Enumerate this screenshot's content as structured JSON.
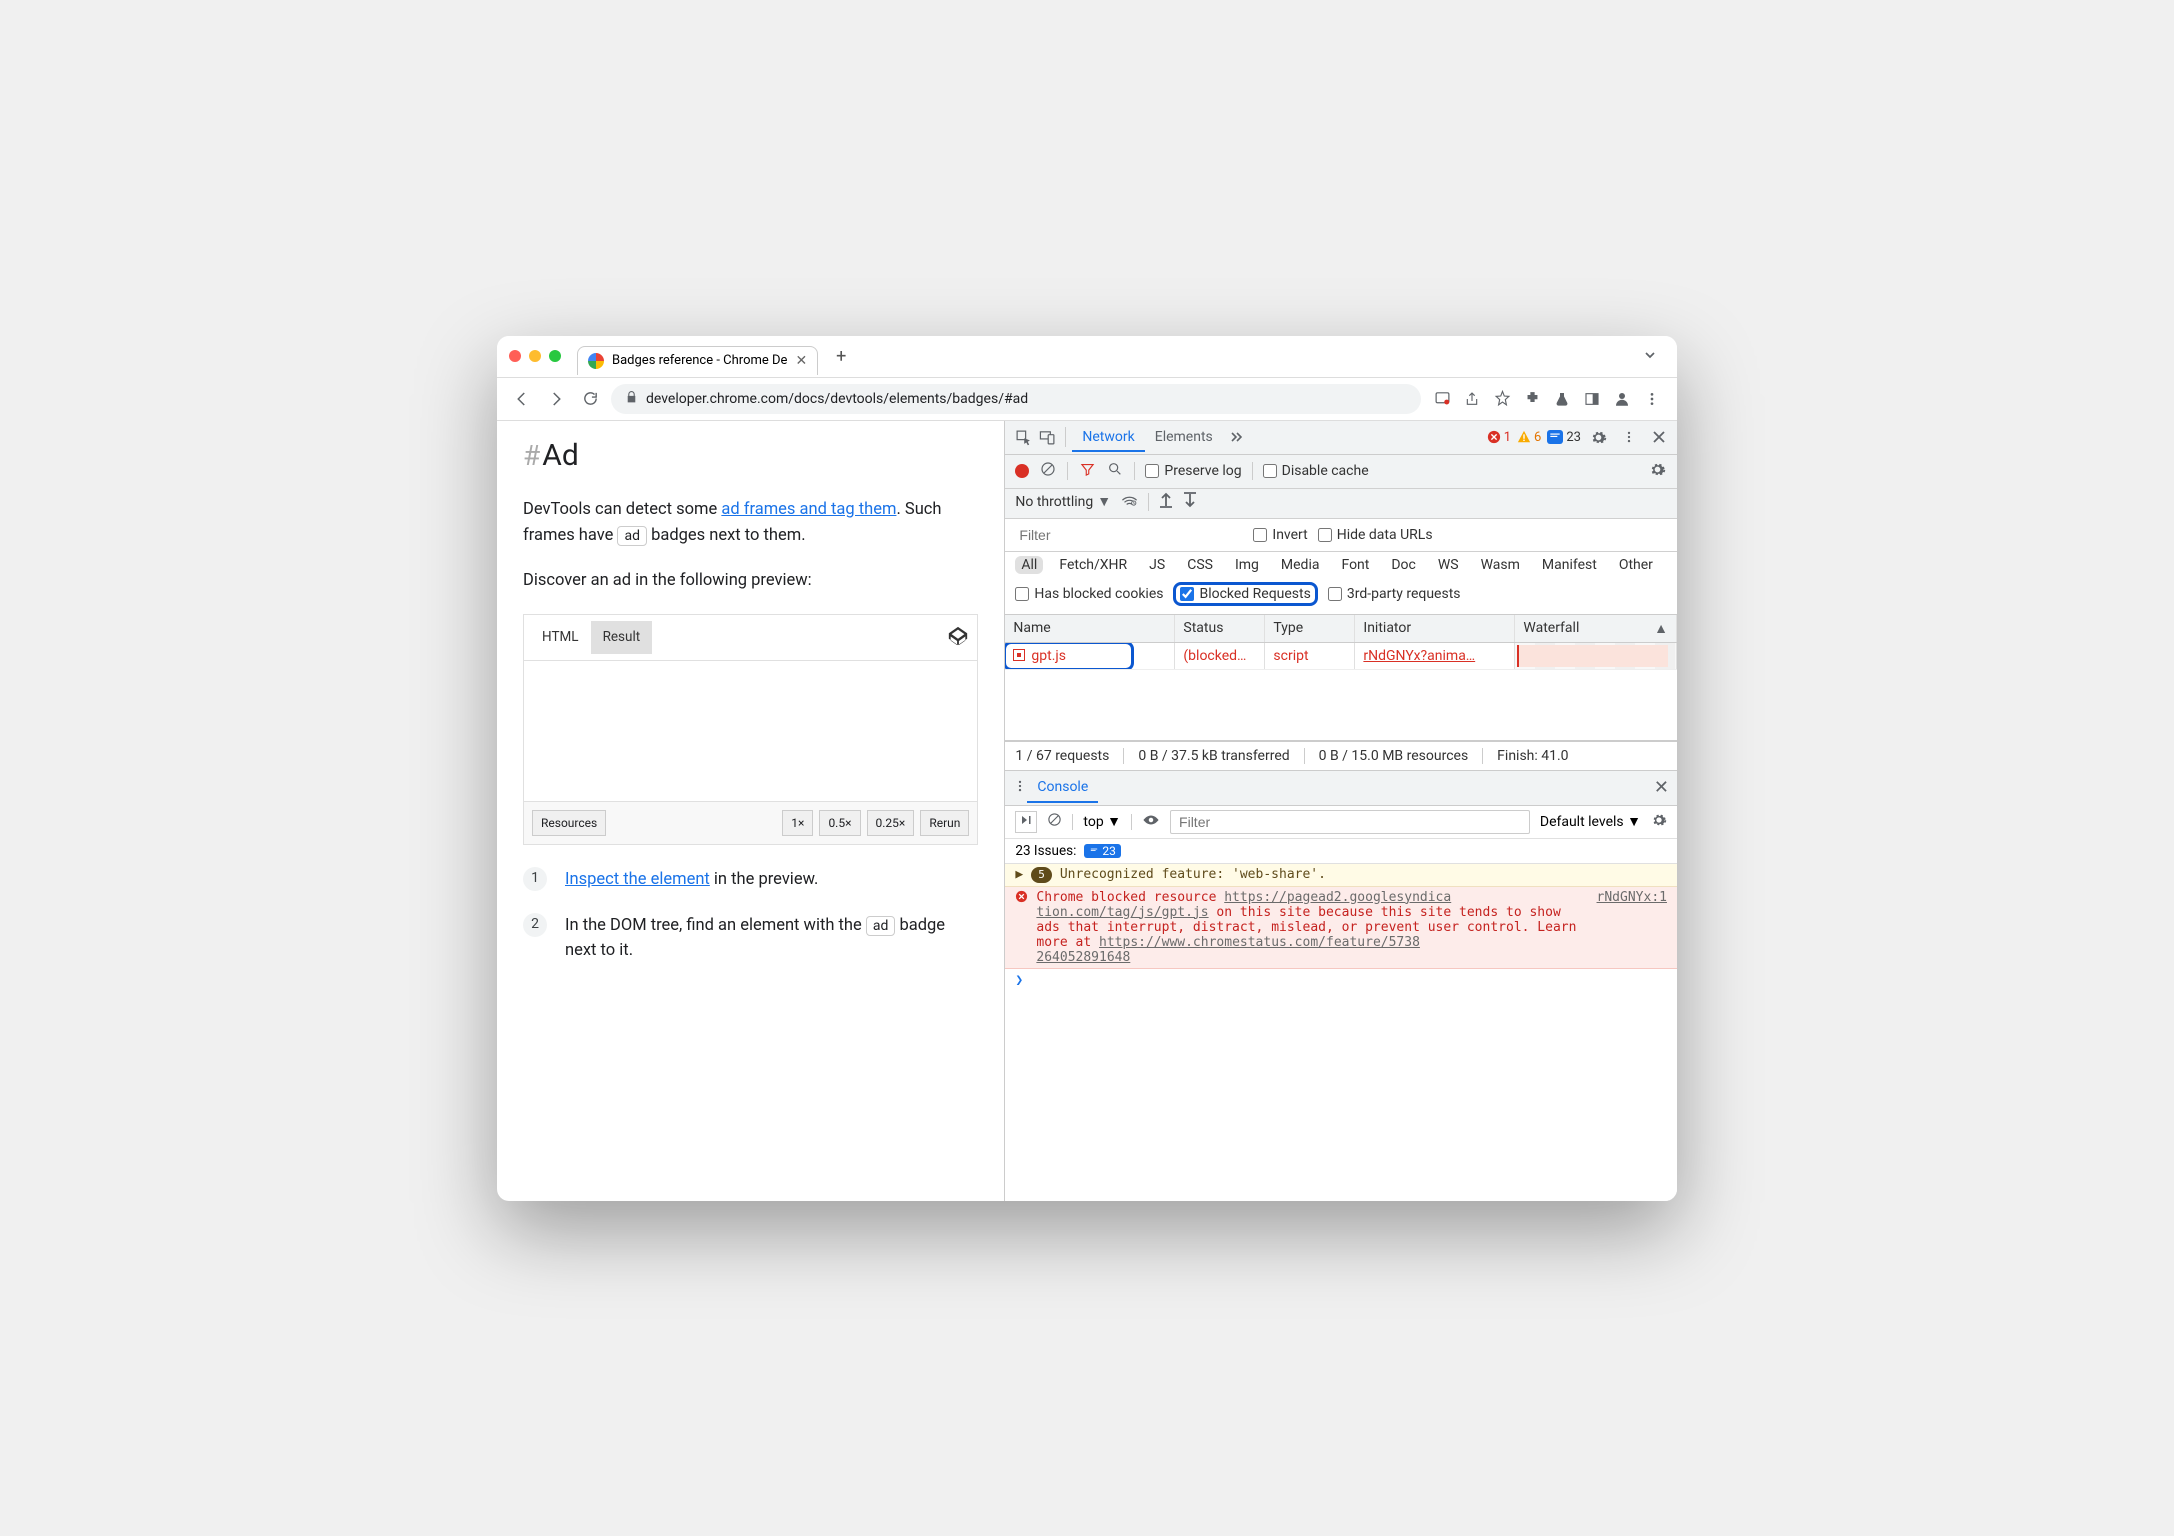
{
  "tab": {
    "title": "Badges reference - Chrome De"
  },
  "url": "developer.chrome.com/docs/devtools/elements/badges/#ad",
  "page": {
    "heading": "Ad",
    "p1_a": "DevTools can detect some ",
    "p1_link": "ad frames and tag them",
    "p1_b": ". Such frames have ",
    "p1_badge": "ad",
    "p1_c": " badges next to them.",
    "p2": "Discover an ad in the following preview:",
    "embed": {
      "tab_html": "HTML",
      "tab_result": "Result",
      "footer": {
        "resources": "Resources",
        "z1": "1×",
        "z05": "0.5×",
        "z025": "0.25×",
        "rerun": "Rerun"
      }
    },
    "steps": {
      "s1_link": "Inspect the element",
      "s1_rest": " in the preview.",
      "s2_a": "In the DOM tree, find an element with the ",
      "s2_badge": "ad",
      "s2_b": " badge next to it."
    }
  },
  "devtools": {
    "tabs": {
      "network": "Network",
      "elements": "Elements"
    },
    "counts": {
      "errors": "1",
      "warnings": "6",
      "messages": "23"
    },
    "nt": {
      "preserve": "Preserve log",
      "disablecache": "Disable cache",
      "throttle": "No throttling"
    },
    "filter": {
      "placeholder": "Filter",
      "invert": "Invert",
      "hideurls": "Hide data URLs",
      "types": [
        "All",
        "Fetch/XHR",
        "JS",
        "CSS",
        "Img",
        "Media",
        "Font",
        "Doc",
        "WS",
        "Wasm",
        "Manifest",
        "Other"
      ],
      "hasblocked": "Has blocked cookies",
      "blockedreq": "Blocked Requests",
      "thirdparty": "3rd-party requests"
    },
    "table": {
      "cols": {
        "name": "Name",
        "status": "Status",
        "type": "Type",
        "initiator": "Initiator",
        "waterfall": "Waterfall"
      },
      "row": {
        "name": "gpt.js",
        "status": "(blocked…",
        "type": "script",
        "initiator": "rNdGNYx?anima…"
      }
    },
    "status": {
      "reqs": "1 / 67 requests",
      "trans": "0 B / 37.5 kB transferred",
      "res": "0 B / 15.0 MB resources",
      "finish": "Finish: 41.0"
    },
    "console": {
      "tab": "Console",
      "top": "top",
      "filter_placeholder": "Filter",
      "levels": "Default levels",
      "issues_label": "23 Issues:",
      "issues_count": "23",
      "warn_count": "5",
      "warn_text": "Unrecognized feature: 'web-share'.",
      "err_text_a": "Chrome blocked resource ",
      "err_url1_a": "https://pagead2.googlesyndica",
      "err_url1_b": "tion.com/tag/js/gpt.js",
      "err_text_b": " on this site because this site tends to show ads that interrupt, distract, mislead, or prevent user control. Learn more at ",
      "err_url2_a": "https://www.chromestatus.com/feature/5738",
      "err_url2_b": "264052891648",
      "err_src": "rNdGNYx:1"
    }
  }
}
